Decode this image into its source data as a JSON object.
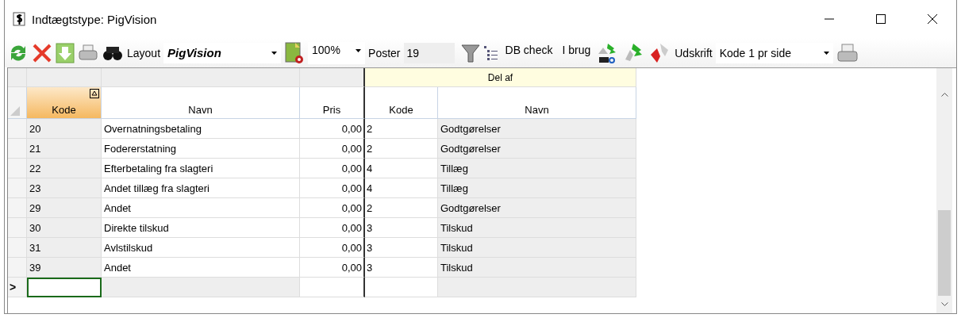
{
  "window": {
    "title": "Indtægtstype: PigVision"
  },
  "toolbar": {
    "layout_label": "Layout",
    "layout_value": "PigVision",
    "zoom": "100%",
    "poster_label": "Poster",
    "poster_value": "19",
    "db_check": "DB check",
    "in_use": "I brug",
    "print_label": "Udskrift",
    "print_value": "Kode 1 pr side"
  },
  "table": {
    "group_header": "Del af",
    "columns": [
      {
        "label": "Kode",
        "sorted": true
      },
      {
        "label": "Navn",
        "sorted": false
      },
      {
        "label": "Pris",
        "sorted": false
      },
      {
        "label": "Kode",
        "sorted": false
      },
      {
        "label": "Navn",
        "sorted": false
      }
    ],
    "rows": [
      [
        "20",
        "Overnatningsbetaling",
        "0,00",
        "2",
        "Godtgørelser"
      ],
      [
        "21",
        "Fodererstatning",
        "0,00",
        "2",
        "Godtgørelser"
      ],
      [
        "22",
        "Efterbetaling fra slagteri",
        "0,00",
        "4",
        "Tillæg"
      ],
      [
        "23",
        "Andet tillæg fra slagteri",
        "0,00",
        "4",
        "Tillæg"
      ],
      [
        "29",
        "Andet",
        "0,00",
        "2",
        "Godtgørelser"
      ],
      [
        "30",
        "Direkte tilskud",
        "0,00",
        "3",
        "Tilskud"
      ],
      [
        "31",
        "Avlstilskud",
        "0,00",
        "3",
        "Tilskud"
      ],
      [
        "39",
        "Andet",
        "0,00",
        "3",
        "Tilskud"
      ]
    ],
    "new_row_marker": ">"
  }
}
